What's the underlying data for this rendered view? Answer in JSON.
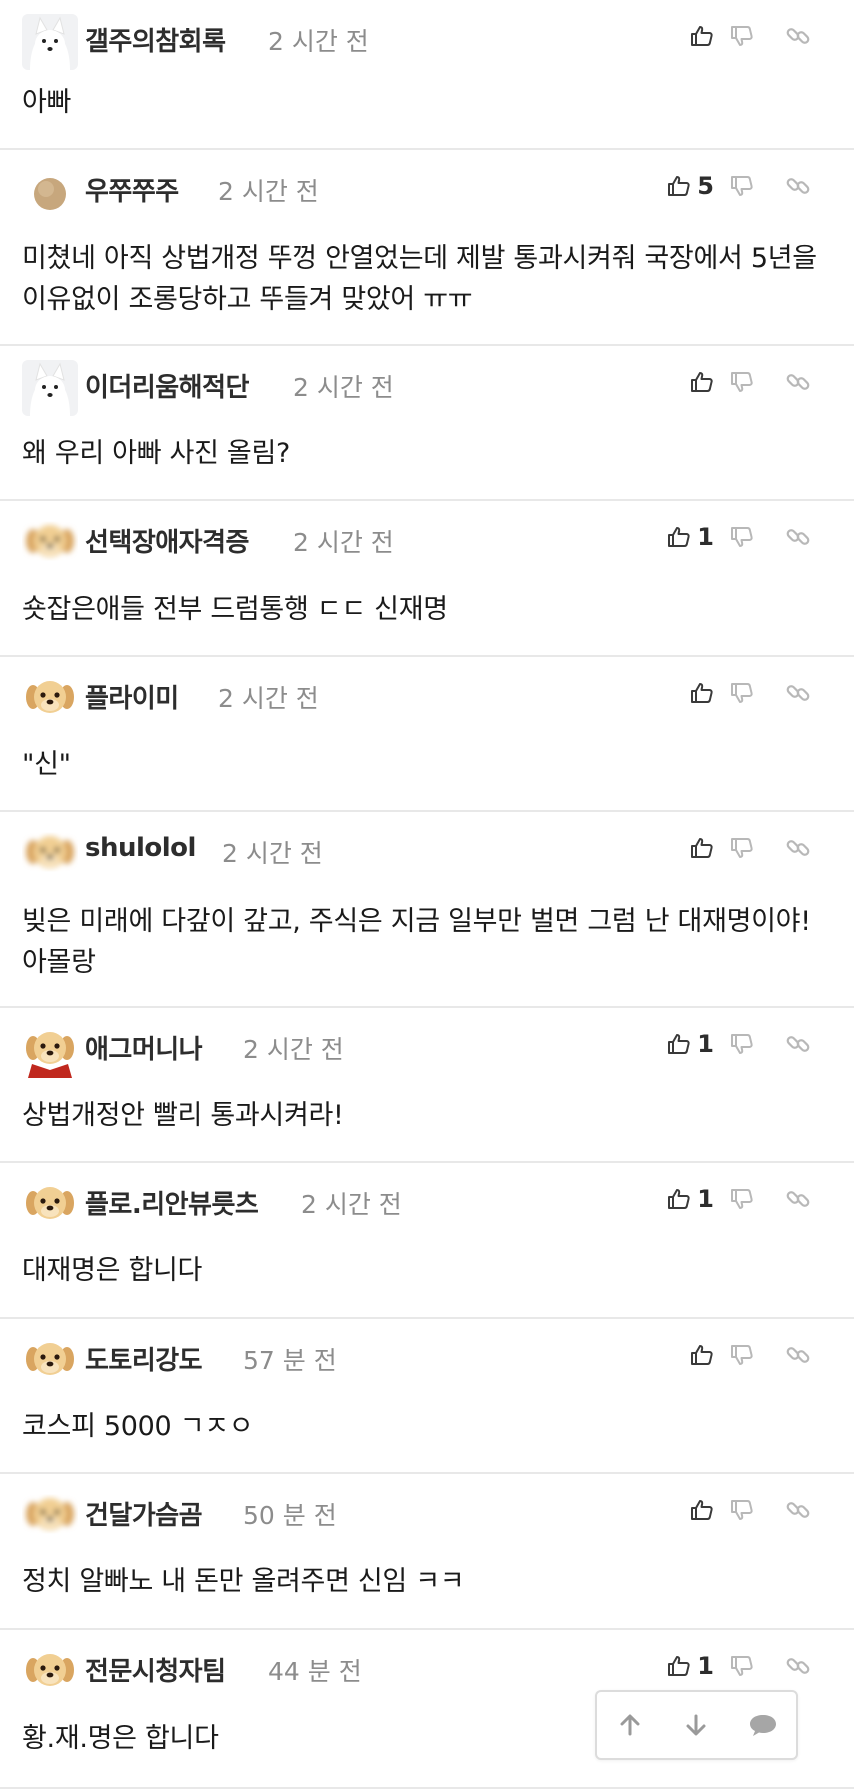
{
  "comments": [
    {
      "username": "갤주의참회록",
      "time": "2 시간 전",
      "likes": "",
      "text": "아빠",
      "avatar": "white-dog"
    },
    {
      "username": "우쭈쭈주",
      "time": "2 시간 전",
      "likes": "5",
      "text": "미쳤네 아직 상법개정 뚜껑 안열었는데 제발 통과시켜줘 국장에서 5년을 이유없이 조롱당하고 뚜들겨 맞았어 ㅠㅠ",
      "avatar": "tan-circle"
    },
    {
      "username": "이더리움해적단",
      "time": "2 시간 전",
      "likes": "",
      "text": "왜 우리 아빠 사진 올림?",
      "avatar": "white-dog"
    },
    {
      "username": "선택장애자격증",
      "time": "2 시간 전",
      "likes": "1",
      "text": "숏잡은애들 전부 드럼통행 ㄷㄷ 신재명",
      "avatar": "puppy-blur"
    },
    {
      "username": "플라이미",
      "time": "2 시간 전",
      "likes": "",
      "text": "\"신\"",
      "avatar": "puppy"
    },
    {
      "username": "shulolol",
      "time": "2 시간 전",
      "likes": "",
      "text": "빚은 미래에 다갚이 갚고, 주식은 지금 일부만 벌면 그럼 난 대재명이야! 아몰랑",
      "avatar": "puppy-blur"
    },
    {
      "username": "애그머니나",
      "time": "2 시간 전",
      "likes": "1",
      "text": "상법개정안 빨리 통과시켜라!",
      "avatar": "puppy-red"
    },
    {
      "username": "플로.리안뷰릇츠",
      "time": "2 시간 전",
      "likes": "1",
      "text": "대재명은 합니다",
      "avatar": "puppy"
    },
    {
      "username": "도토리강도",
      "time": "57 분 전",
      "likes": "",
      "text": "코스피 5000 ㄱㅈㅇ",
      "avatar": "puppy"
    },
    {
      "username": "건달가슴곰",
      "time": "50 분 전",
      "likes": "",
      "text": "정치 알빠노 내 돈만 올려주면 신임 ㅋㅋ",
      "avatar": "puppy-blur"
    },
    {
      "username": "전문시청자팀",
      "time": "44 분 전",
      "likes": "1",
      "text": "황.재.명은 합니다",
      "avatar": "puppy"
    }
  ],
  "icons": {
    "like": "thumbs-up-icon",
    "dislike": "thumbs-down-icon",
    "share": "link-icon",
    "scroll_up": "arrow-up-icon",
    "scroll_down": "arrow-down-icon",
    "comment": "speech-bubble-icon"
  },
  "colors": {
    "text": "#1a1a1a",
    "username": "#2d2d2d",
    "meta": "#8c8c8c",
    "icon": "#3a3a3a",
    "icon_muted": "#b8b8b8",
    "divider": "#e8e8e8"
  }
}
